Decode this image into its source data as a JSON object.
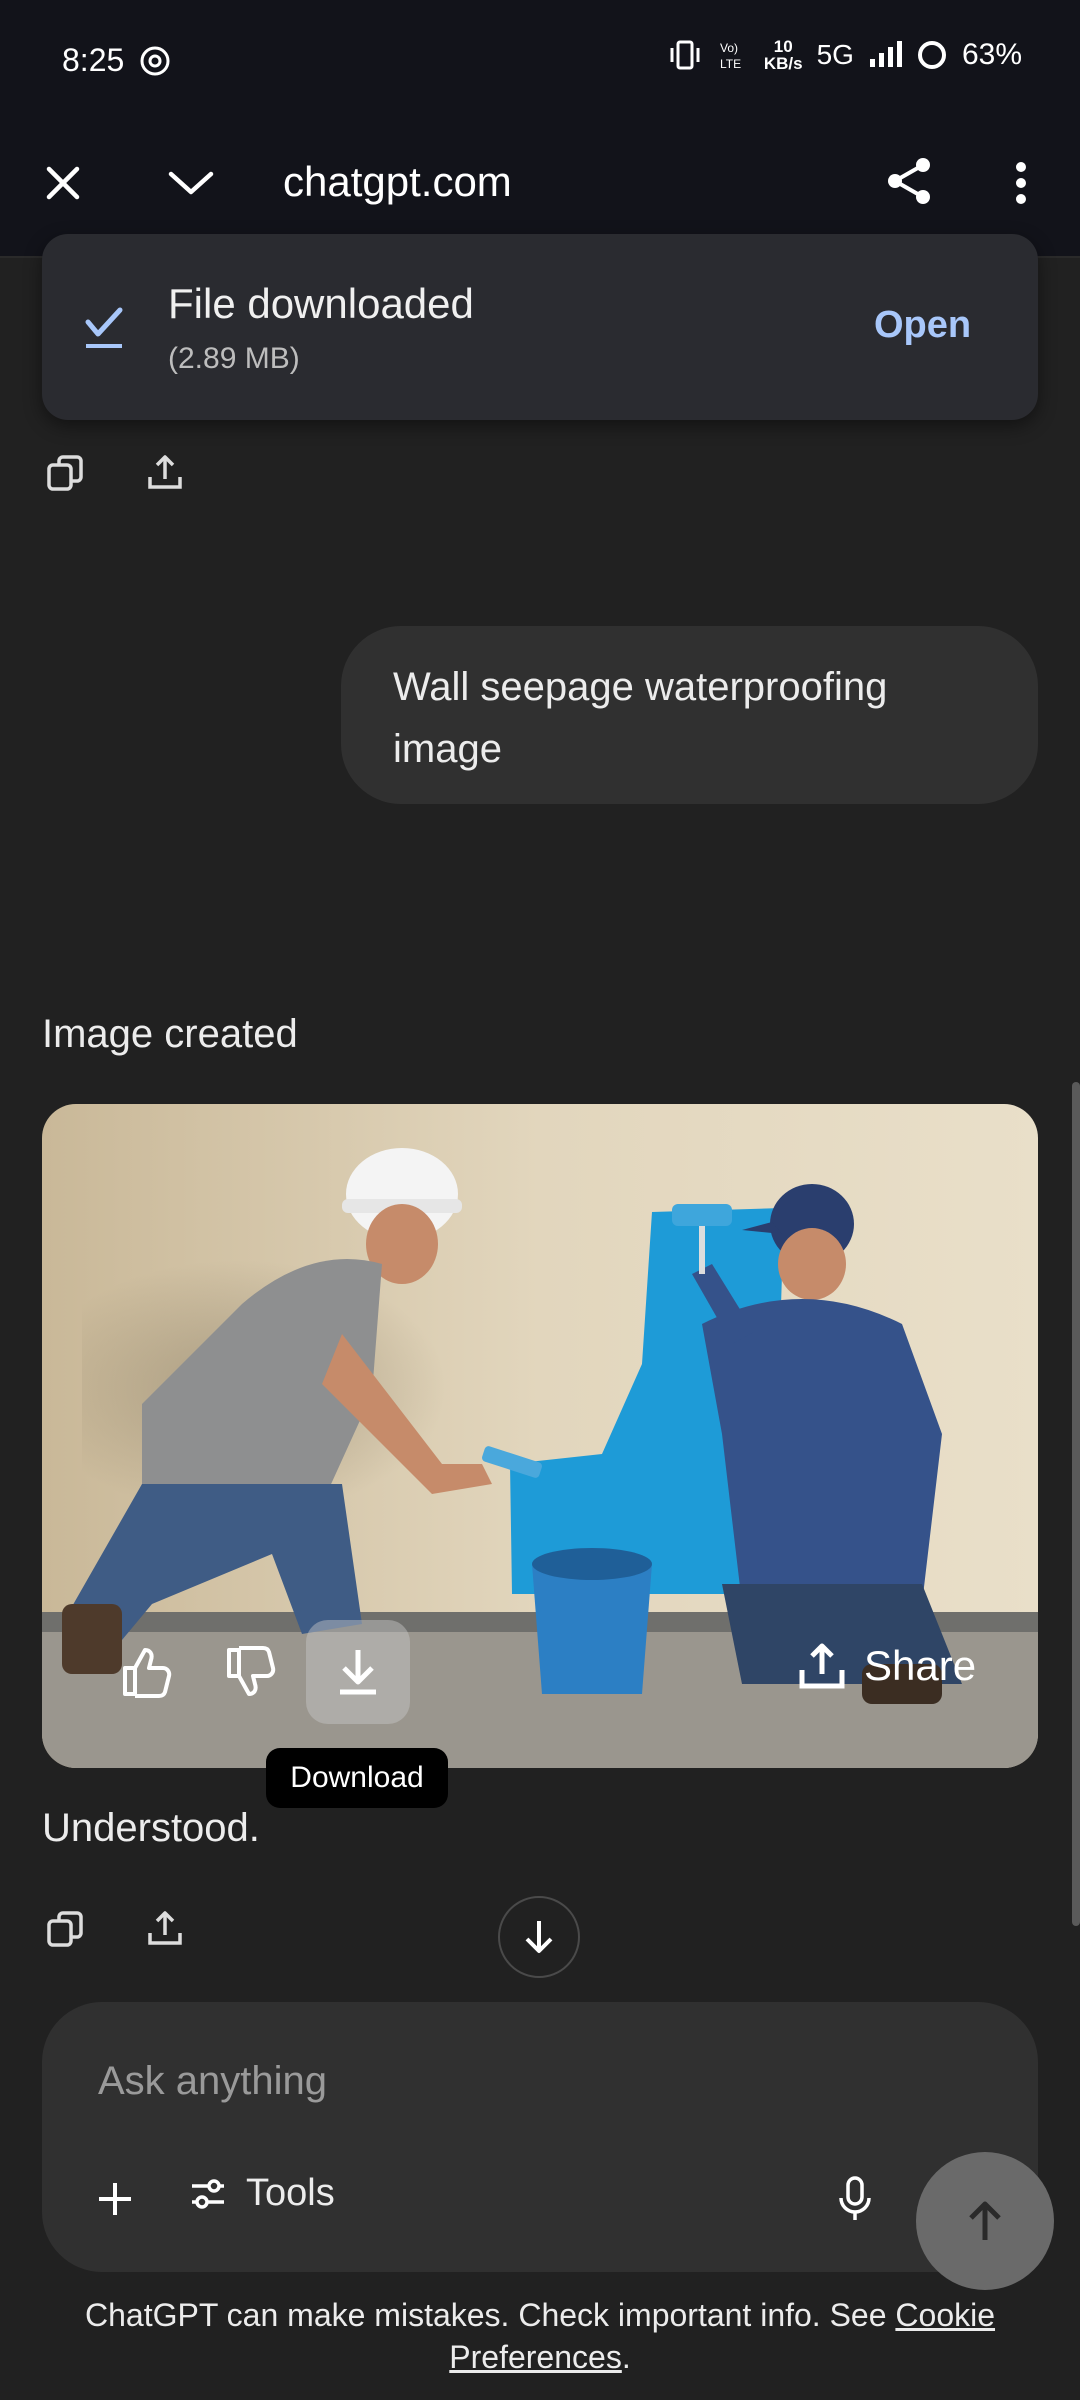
{
  "status_bar": {
    "time": "8:25",
    "network_speed_top": "10",
    "network_speed_bottom": "KB/s",
    "network_type": "5G",
    "battery": "63%",
    "icons": [
      "chatgpt-icon",
      "vibrate-icon",
      "volte-icon",
      "signal-icon",
      "battery-ring-icon"
    ]
  },
  "browser": {
    "url": "chatgpt.com",
    "icons": [
      "close-icon",
      "chevron-down-icon",
      "share-icon",
      "more-vert-icon"
    ]
  },
  "download_snackbar": {
    "title": "File downloaded",
    "size": "(2.89 MB)",
    "action": "Open",
    "accent": "#a8c7fa"
  },
  "conversation": {
    "user_message": "Wall seepage waterproofing image",
    "image_status": "Image created",
    "image_actions": {
      "share_label": "Share"
    },
    "tooltip": "Download",
    "assistant_reply": "Understood."
  },
  "composer": {
    "placeholder": "Ask anything",
    "tools_label": "Tools"
  },
  "disclaimer": {
    "text": "ChatGPT can make mistakes. Check important info. See ",
    "link": "Cookie Preferences",
    "end": "."
  },
  "colors": {
    "background": "#212121",
    "toolbar": "#12131a",
    "bubble": "#303030",
    "paint_blue": "#1e9bd7"
  }
}
